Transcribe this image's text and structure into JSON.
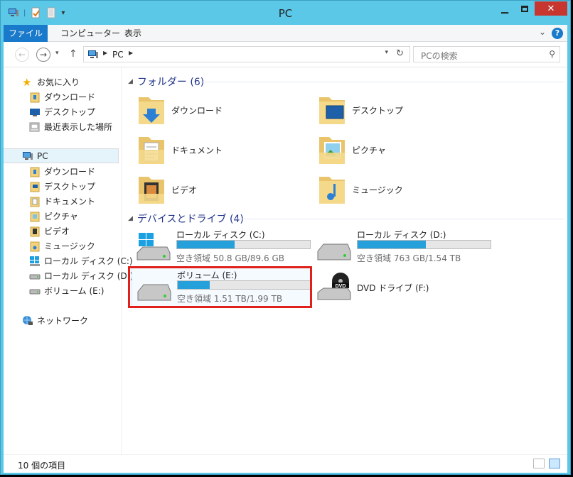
{
  "window": {
    "title": "PC"
  },
  "ribbon": {
    "tabs": [
      "ファイル",
      "コンピューター",
      "表示"
    ],
    "help": "?"
  },
  "nav": {
    "path_root": "PC"
  },
  "search": {
    "placeholder": "PCの検索"
  },
  "sidebar": {
    "favorites": {
      "label": "お気に入り",
      "items": [
        "ダウンロード",
        "デスクトップ",
        "最近表示した場所"
      ]
    },
    "pc": {
      "label": "PC",
      "items": [
        "ダウンロード",
        "デスクトップ",
        "ドキュメント",
        "ピクチャ",
        "ビデオ",
        "ミュージック",
        "ローカル ディスク (C:)",
        "ローカル ディスク (D:)",
        "ボリューム (E:)"
      ]
    },
    "network": {
      "label": "ネットワーク"
    }
  },
  "folders": {
    "heading": "フォルダー (6)",
    "items": [
      {
        "label": "ダウンロード",
        "kind": "download"
      },
      {
        "label": "デスクトップ",
        "kind": "desktop"
      },
      {
        "label": "ドキュメント",
        "kind": "documents"
      },
      {
        "label": "ピクチャ",
        "kind": "pictures"
      },
      {
        "label": "ビデオ",
        "kind": "videos"
      },
      {
        "label": "ミュージック",
        "kind": "music"
      }
    ]
  },
  "drives": {
    "heading": "デバイスとドライブ (4)",
    "items": [
      {
        "name": "ローカル ディスク (C:)",
        "free_text": "空き領域 50.8 GB/89.6 GB",
        "used_fraction": 0.433
      },
      {
        "name": "ローカル ディスク (D:)",
        "free_text": "空き領域 763 GB/1.54 TB",
        "used_fraction": 0.516
      },
      {
        "name": "ボリューム (E:)",
        "free_text": "空き領域 1.51 TB/1.99 TB",
        "used_fraction": 0.241
      },
      {
        "name": "DVD ドライブ (F:)"
      }
    ]
  },
  "status": {
    "item_count": "10 個の項目"
  },
  "colors": {
    "accent": "#1979ca",
    "titlebar": "#5bc8e8",
    "close": "#c7372f",
    "bar_fill": "#26a0da",
    "highlight": "#e0201b"
  }
}
